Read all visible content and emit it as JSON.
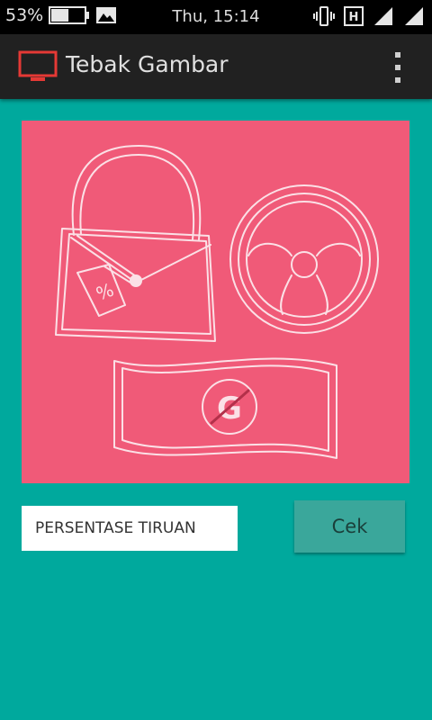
{
  "status_bar": {
    "battery_percent": "53%",
    "battery_level": 0.53,
    "clock": "Thu, 15:14",
    "icons": [
      "battery-icon",
      "image-notification-icon",
      "vibrate-icon",
      "h-network-icon",
      "signal-icon",
      "signal-icon-2"
    ]
  },
  "app_bar": {
    "title": "Tebak Gambar",
    "logo_icon": "monitor-icon",
    "logo_color": "#e53935",
    "menu_icon": "overflow-menu-icon"
  },
  "puzzle": {
    "background_color": "#f05a78",
    "items": [
      "handbag-with-discount-tag",
      "steering-wheel",
      "banknote-with-crossed-g"
    ]
  },
  "answer_input": {
    "placeholder": "PERSENTASE TIRUAN",
    "value": ""
  },
  "check_button": {
    "label": "Cek",
    "color": "#3aa79b"
  },
  "colors": {
    "background": "#00a99d",
    "app_bar": "#212121",
    "status_bar": "#000000"
  }
}
